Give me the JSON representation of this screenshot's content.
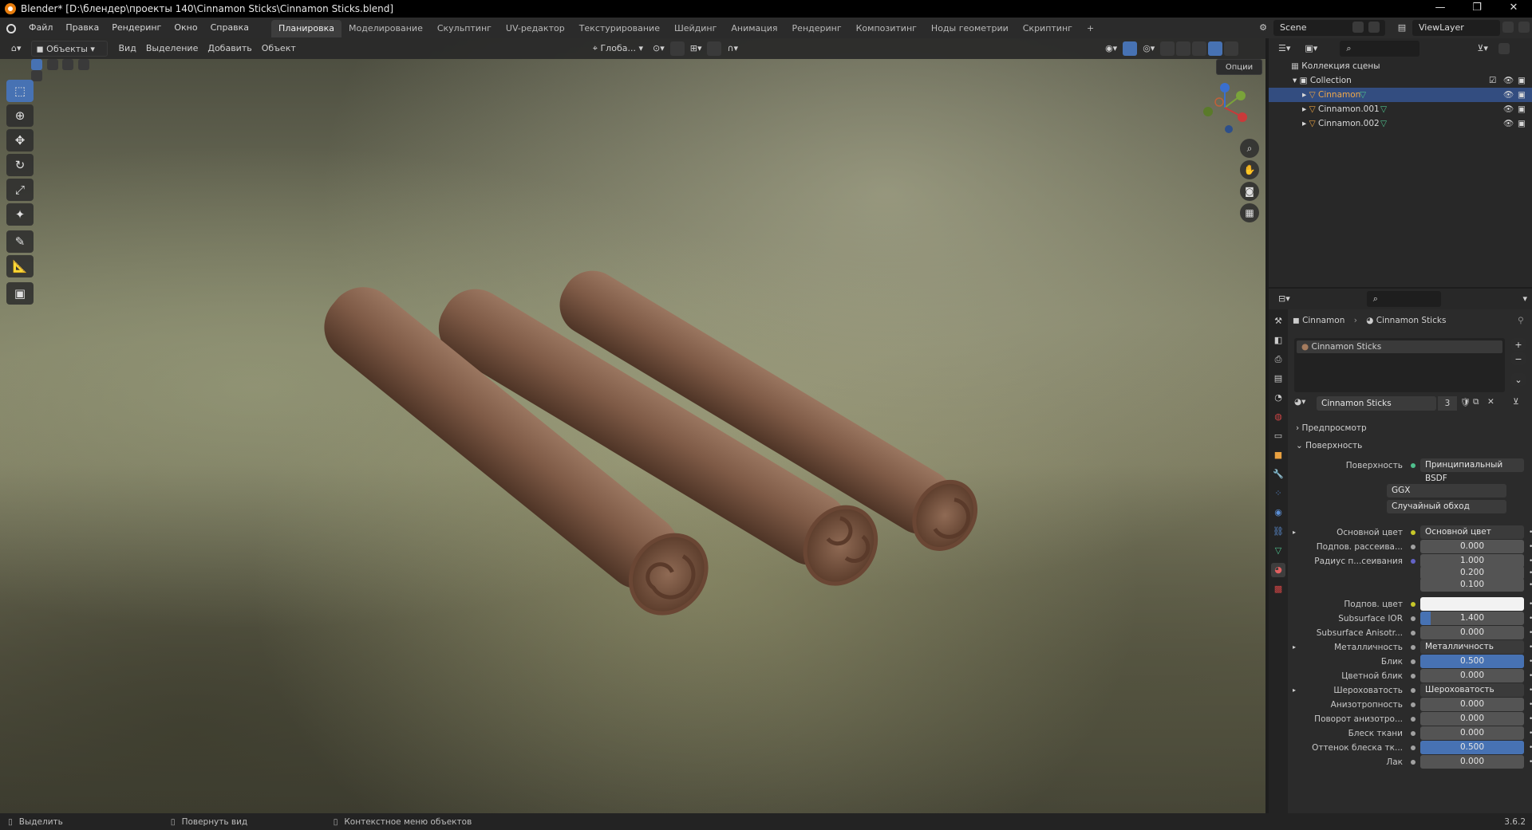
{
  "window": {
    "title": "Blender* [D:\\блендер\\проекты 140\\Cinnamon Sticks\\Cinnamon Sticks.blend]",
    "minimize": "—",
    "maximize": "❐",
    "close": "✕"
  },
  "menubar": {
    "items": [
      "Файл",
      "Правка",
      "Рендеринг",
      "Окно",
      "Справка"
    ],
    "workspaces": [
      "Планировка",
      "Моделирование",
      "Скульптинг",
      "UV-редактор",
      "Текстурирование",
      "Шейдинг",
      "Анимация",
      "Рендеринг",
      "Композитинг",
      "Ноды геометрии",
      "Скриптинг"
    ],
    "active_workspace": "Планировка",
    "add_tab": "+",
    "scene": "Scene",
    "view_layer": "ViewLayer"
  },
  "viewport_header": {
    "mode": "Объекты",
    "menus": [
      "Вид",
      "Выделение",
      "Добавить",
      "Объект"
    ],
    "transform_orientation": "Глоба...",
    "options": "Опции"
  },
  "outliner": {
    "scene_collection": "Коллекция сцены",
    "collection": "Collection",
    "objects": [
      {
        "name": "Cinnamon",
        "selected": true
      },
      {
        "name": "Cinnamon.001",
        "selected": false
      },
      {
        "name": "Cinnamon.002",
        "selected": false
      }
    ]
  },
  "properties": {
    "breadcrumb_object": "Cinnamon",
    "breadcrumb_material": "Cinnamon Sticks",
    "slot_material": "Cinnamon Sticks",
    "material_name": "Cinnamon Sticks",
    "material_users": "3",
    "panel_preview": "Предпросмотр",
    "panel_surface": "Поверхность",
    "surface_label": "Поверхность",
    "surface_shader": "Принципиальный BSDF",
    "distribution": "GGX",
    "subsurface_method": "Случайный обход",
    "rows": [
      {
        "label": "Основной цвет",
        "value": "Основной цвет",
        "kind": "link",
        "dot": "#c7c729",
        "expand": true
      },
      {
        "label": "Подпов. рассеива...",
        "value": "0.000",
        "kind": "num",
        "dot": "#a1a1a1",
        "fill": 0
      },
      {
        "label": "Радиус п...сеивания",
        "value": "1.000",
        "kind": "num",
        "dot": "#6363c7",
        "fill": 0
      },
      {
        "label": "",
        "value": "0.200",
        "kind": "num",
        "dot": "",
        "fill": 0
      },
      {
        "label": "",
        "value": "0.100",
        "kind": "num",
        "dot": "",
        "fill": 0
      },
      {
        "label": "Подпов. цвет",
        "value": "",
        "kind": "color",
        "dot": "#c7c729",
        "fill": 0
      },
      {
        "label": "Subsurface IOR",
        "value": "1.400",
        "kind": "num",
        "dot": "#a1a1a1",
        "fill": 0.1
      },
      {
        "label": "Subsurface Anisotr...",
        "value": "0.000",
        "kind": "num",
        "dot": "#a1a1a1",
        "fill": 0
      },
      {
        "label": "Металличность",
        "value": "Металличность",
        "kind": "link",
        "dot": "#a1a1a1",
        "expand": true
      },
      {
        "label": "Блик",
        "value": "0.500",
        "kind": "num",
        "dot": "#a1a1a1",
        "fill": 1
      },
      {
        "label": "Цветной блик",
        "value": "0.000",
        "kind": "num",
        "dot": "#a1a1a1",
        "fill": 0
      },
      {
        "label": "Шероховатость",
        "value": "Шероховатость",
        "kind": "link",
        "dot": "#a1a1a1",
        "expand": true
      },
      {
        "label": "Анизотропность",
        "value": "0.000",
        "kind": "num",
        "dot": "#a1a1a1",
        "fill": 0
      },
      {
        "label": "Поворот анизотро...",
        "value": "0.000",
        "kind": "num",
        "dot": "#a1a1a1",
        "fill": 0
      },
      {
        "label": "Блеск ткани",
        "value": "0.000",
        "kind": "num",
        "dot": "#a1a1a1",
        "fill": 0
      },
      {
        "label": "Оттенок блеска тк...",
        "value": "0.500",
        "kind": "num",
        "dot": "#a1a1a1",
        "fill": 1
      },
      {
        "label": "Лак",
        "value": "0.000",
        "kind": "num",
        "dot": "#a1a1a1",
        "fill": 0
      }
    ]
  },
  "statusbar": {
    "select": "Выделить",
    "rotate_view": "Повернуть вид",
    "context_menu": "Контекстное меню объектов",
    "version": "3.6.2"
  },
  "colors": {
    "accent": "#4772b3",
    "selection": "#334d80",
    "header": "#2b2b2b"
  }
}
